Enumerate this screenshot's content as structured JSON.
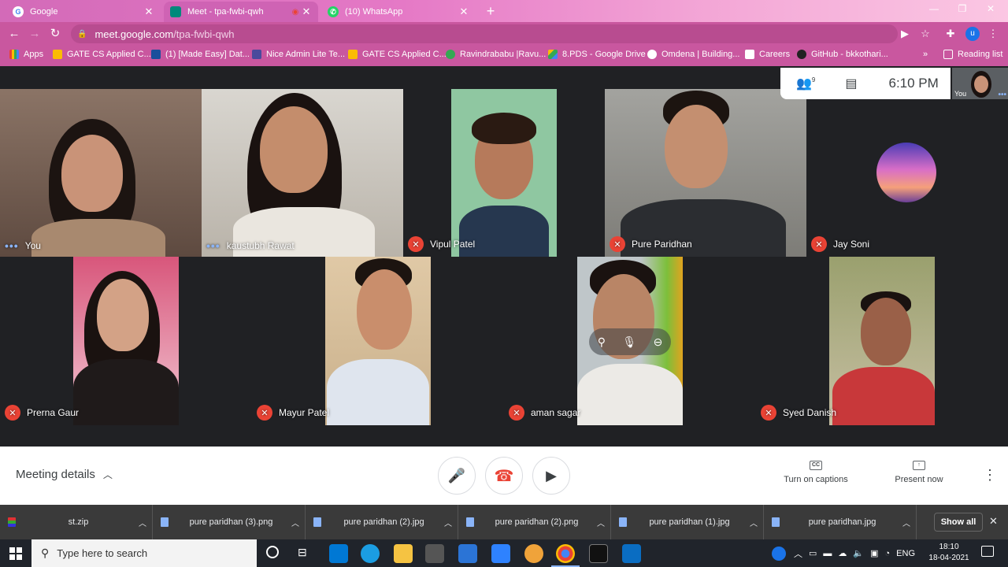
{
  "browser": {
    "tabs": [
      {
        "title": "Google",
        "favicon": "google-g-icon"
      },
      {
        "title": "Meet - tpa-fwbi-qwh",
        "favicon": "meet-icon"
      },
      {
        "title": "(10) WhatsApp",
        "favicon": "whatsapp-icon"
      }
    ],
    "url_host": "meet.google.com",
    "url_path": "/tpa-fwbi-qwh",
    "profile_initial": "u",
    "bookmarks": [
      {
        "label": "Apps"
      },
      {
        "label": "GATE CS Applied C..."
      },
      {
        "label": "(1) [Made Easy] Dat..."
      },
      {
        "label": "Nice Admin Lite Te..."
      },
      {
        "label": "GATE CS Applied C..."
      },
      {
        "label": "Ravindrababu |Ravu..."
      },
      {
        "label": "8.PDS - Google Drive"
      },
      {
        "label": "Omdena | Building..."
      },
      {
        "label": "Careers"
      },
      {
        "label": "GitHub - bkkothari..."
      }
    ],
    "more_bookmarks": "»",
    "reading_list": "Reading list"
  },
  "meet": {
    "participant_count_badge": "9",
    "time": "6:10 PM",
    "self_pip_label": "You",
    "participants": [
      {
        "name": "You",
        "muted": false
      },
      {
        "name": "kaustubh Rawat",
        "muted": false
      },
      {
        "name": "Vipul Patel",
        "muted": true
      },
      {
        "name": "Pure Paridhan",
        "muted": true
      },
      {
        "name": "Jay Soni",
        "muted": true
      },
      {
        "name": "Prerna Gaur",
        "muted": true
      },
      {
        "name": "Mayur Patel",
        "muted": true
      },
      {
        "name": "aman sagar",
        "muted": true
      },
      {
        "name": "Syed Danish",
        "muted": true
      }
    ],
    "meeting_details": "Meeting details",
    "captions_label": "Turn on captions",
    "captions_icon_text": "CC",
    "present_label": "Present now"
  },
  "downloads": {
    "items": [
      "st.zip",
      "pure paridhan (3).png",
      "pure paridhan (2).jpg",
      "pure paridhan (2).png",
      "pure paridhan (1).jpg",
      "pure paridhan.jpg"
    ],
    "show_all": "Show all"
  },
  "taskbar": {
    "search_placeholder": "Type here to search",
    "language": "ENG",
    "time": "18:10",
    "date": "18-04-2021"
  }
}
